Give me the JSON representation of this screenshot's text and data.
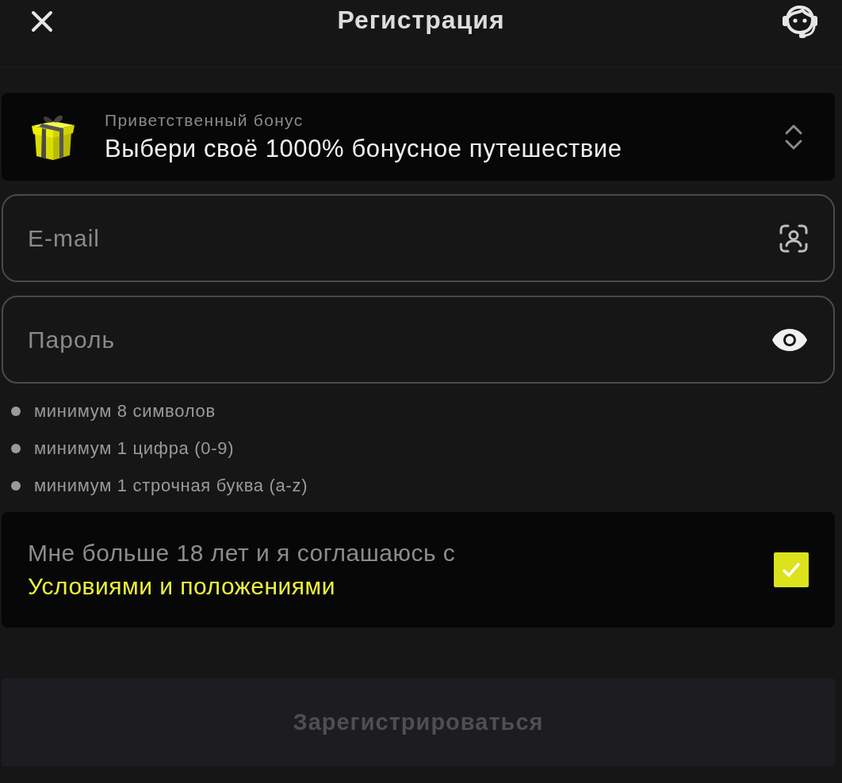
{
  "header": {
    "title": "Регистрация"
  },
  "bonus": {
    "label": "Приветственный бонус",
    "value": "Выбери своё 1000% бонусное путешествие"
  },
  "fields": [
    {
      "kind": "email",
      "placeholder": "E-mail"
    },
    {
      "kind": "password",
      "placeholder": "Пароль"
    }
  ],
  "password_rules": [
    {
      "text": "минимум 8 символов",
      "met": false
    },
    {
      "text": "минимум 1 цифра (0-9)",
      "met": false
    },
    {
      "text": "минимум 1 строчная буква (a-z)",
      "met": false
    }
  ],
  "consent": {
    "text": "Мне больше 18 лет и я соглашаюсь с",
    "link": "Условиями и положениями",
    "checked": true
  },
  "submit": {
    "label": "Зарегистрироваться",
    "disabled": true
  }
}
